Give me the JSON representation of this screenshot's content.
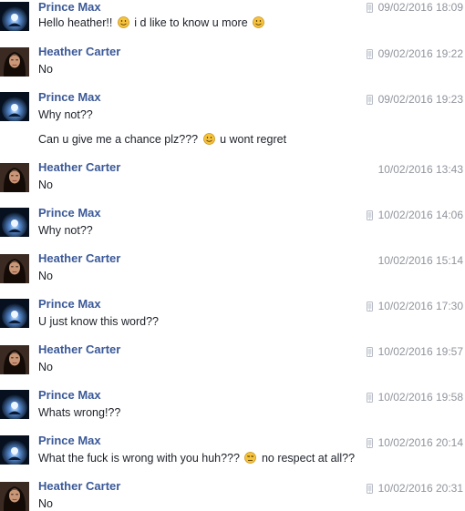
{
  "colors": {
    "name": "#3b5998",
    "text": "#1d2129",
    "timestamp": "#90949c",
    "emoji": "#f5c33b"
  },
  "icons": {
    "mobile_indicator": "mobile-phone-icon",
    "smile": "smiling-emoji-icon",
    "unamused": "unamused-emoji-icon"
  },
  "messages": [
    {
      "author": "Prince Max",
      "time": "09/02/2016 18:09",
      "mobile": true,
      "parts": [
        {
          "text": "Hello heather!!"
        },
        {
          "emoji": "smile"
        },
        {
          "text": "i d like to know u more"
        },
        {
          "emoji": "smile"
        }
      ]
    },
    {
      "author": "Heather Carter",
      "time": "09/02/2016 19:22",
      "mobile": true,
      "text": "No"
    },
    {
      "author": "Prince Max",
      "time": "09/02/2016 19:23",
      "mobile": true,
      "text": "Why not??"
    },
    {
      "continuation": true,
      "parts": [
        {
          "text": "Can u give me a chance plz???"
        },
        {
          "emoji": "smile"
        },
        {
          "text": "u wont regret"
        }
      ]
    },
    {
      "author": "Heather Carter",
      "time": "10/02/2016 13:43",
      "mobile": false,
      "text": "No"
    },
    {
      "author": "Prince Max",
      "time": "10/02/2016 14:06",
      "mobile": true,
      "text": "Why not??"
    },
    {
      "author": "Heather Carter",
      "time": "10/02/2016 15:14",
      "mobile": false,
      "text": "No"
    },
    {
      "author": "Prince Max",
      "time": "10/02/2016 17:30",
      "mobile": true,
      "text": "U just know this word??"
    },
    {
      "author": "Heather Carter",
      "time": "10/02/2016 19:57",
      "mobile": true,
      "text": "No"
    },
    {
      "author": "Prince Max",
      "time": "10/02/2016 19:58",
      "mobile": true,
      "text": "Whats wrong!??"
    },
    {
      "author": "Prince Max",
      "time": "10/02/2016 20:14",
      "mobile": true,
      "parts": [
        {
          "text": "What the fuck is wrong with you huh???"
        },
        {
          "emoji": "unamused"
        },
        {
          "text": "no respect at all??"
        }
      ]
    },
    {
      "author": "Heather Carter",
      "time": "10/02/2016 20:31",
      "mobile": true,
      "text": "No"
    }
  ]
}
